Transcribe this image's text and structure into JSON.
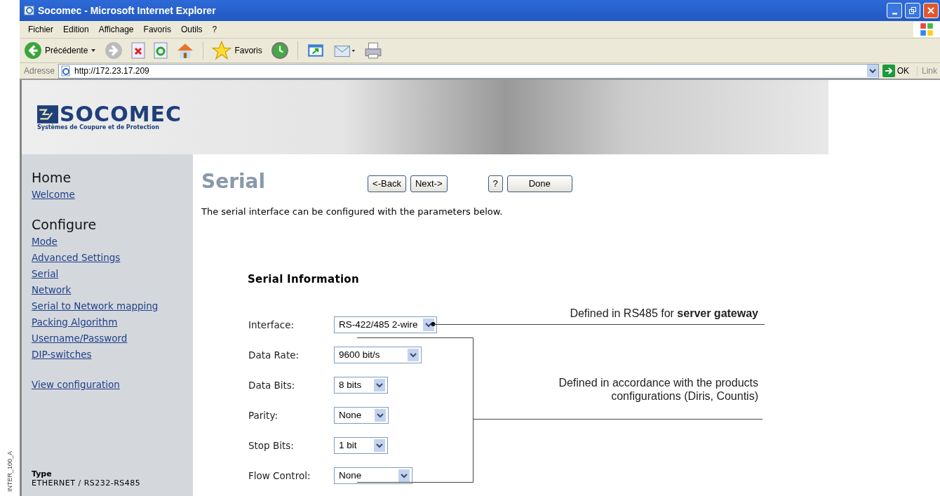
{
  "figure_label": "INTER_100_A",
  "window": {
    "title": "Socomec - Microsoft Internet Explorer"
  },
  "menu": [
    "Fichier",
    "Edition",
    "Affichage",
    "Favoris",
    "Outils",
    "?"
  ],
  "toolbar": {
    "back": "Précédente",
    "favorites": "Favoris"
  },
  "address": {
    "label": "Adresse",
    "url": "http://172.23.17.209",
    "go": "OK",
    "links": "Link"
  },
  "banner": {
    "logo": "SOCOMEC",
    "tagline": "Systèmes de Coupure et de Protection"
  },
  "sidebar": {
    "sections": [
      {
        "heading": "Home",
        "links": [
          "Welcome"
        ]
      },
      {
        "heading": "Configure",
        "links": [
          "Mode",
          "Advanced Settings",
          "Serial",
          "Network",
          "Serial to Network mapping",
          "Packing Algorithm",
          "Username/Password",
          "DIP-switches"
        ]
      },
      {
        "links": [
          "View configuration"
        ]
      }
    ],
    "info": {
      "label": "Type",
      "value": "ETHERNET / RS232-RS485"
    }
  },
  "main": {
    "title": "Serial",
    "nav_buttons": [
      "<-Back",
      "Next->"
    ],
    "help": "?",
    "done": "Done",
    "intro": "The serial interface can be configured with the parameters below.",
    "section": "Serial Information",
    "fields": [
      {
        "label": "Interface:",
        "value": "RS-422/485 2-wire"
      },
      {
        "label": "Data Rate:",
        "value": "9600 bit/s"
      },
      {
        "label": "Data Bits:",
        "value": "8 bits"
      },
      {
        "label": "Parity:",
        "value": "None"
      },
      {
        "label": "Stop Bits:",
        "value": "1 bit"
      },
      {
        "label": "Flow Control:",
        "value": "None"
      }
    ]
  },
  "annotations": [
    {
      "text": "Defined in RS485 for **server gateway**"
    },
    {
      "text": "Defined in accordance with the products configurations (Diris, Countis)"
    }
  ]
}
